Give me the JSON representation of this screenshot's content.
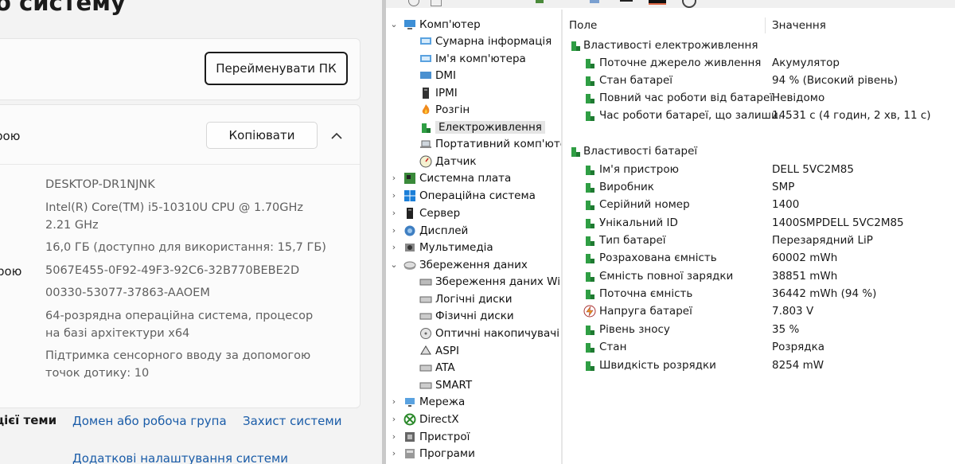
{
  "settings": {
    "title": "о систему",
    "rename_button": "Перейменувати ПК",
    "spec_label": "рою",
    "copy_button": "Копіювати",
    "spec_side_label": "рою",
    "lines": [
      "DESKTOP-DR1NJNK",
      "Intel(R) Core(TM) i5-10310U CPU @ 1.70GHz",
      "2.21 GHz",
      "16,0 ГБ (доступно для використання: 15,7 ГБ)",
      "5067E455-0F92-49F3-92C6-32B770BEBE2D",
      "00330-53077-37863-AAOEM",
      "64-розрядна операційна система, процесор",
      "на базі архітектури x64",
      "Підтримка сенсорного вводу за допомогою",
      "точок дотику: 10"
    ],
    "related_label": "цієї теми",
    "links": [
      "Домен або робоча група",
      "Захист системи",
      "Додаткові налаштування системи"
    ],
    "link_color": "#1a5ca8"
  },
  "tree": [
    {
      "label": "Комп'ютер",
      "arrow": "⌄",
      "icon": "computer-icon"
    },
    {
      "label": "Сумарна інформація",
      "icon": "summary-icon"
    },
    {
      "label": "Ім'я комп'ютера",
      "icon": "computer-name-icon"
    },
    {
      "label": "DMI",
      "icon": "dmi-icon"
    },
    {
      "label": "IPMI",
      "icon": "ipmi-icon"
    },
    {
      "label": "Розгін",
      "icon": "overclock-icon"
    },
    {
      "label": "Електроживлення",
      "icon": "power-icon"
    },
    {
      "label": "Портативний комп'ютер",
      "icon": "portable-icon"
    },
    {
      "label": "Датчик",
      "icon": "sensor-icon"
    },
    {
      "label": "Системна плата",
      "arrow": "›",
      "icon": "motherboard-icon"
    },
    {
      "label": "Операційна система",
      "arrow": "›",
      "icon": "os-icon"
    },
    {
      "label": "Сервер",
      "arrow": "›",
      "icon": "server-icon"
    },
    {
      "label": "Дисплей",
      "arrow": "›",
      "icon": "display-icon"
    },
    {
      "label": "Мультимедіа",
      "arrow": "›",
      "icon": "multimedia-icon"
    },
    {
      "label": "Збереження даних",
      "arrow": "⌄",
      "icon": "storage-icon"
    },
    {
      "label": "Збереження даних Wind",
      "icon": "storage-windows-icon"
    },
    {
      "label": "Логічні диски",
      "icon": "logical-disk-icon"
    },
    {
      "label": "Фізичні диски",
      "icon": "physical-disk-icon"
    },
    {
      "label": "Оптичні накопичувачі",
      "icon": "optical-drive-icon"
    },
    {
      "label": "ASPI",
      "icon": "aspi-icon"
    },
    {
      "label": "ATA",
      "icon": "ata-icon"
    },
    {
      "label": "SMART",
      "icon": "smart-icon"
    },
    {
      "label": "Мережа",
      "arrow": "›",
      "icon": "network-icon"
    },
    {
      "label": "DirectX",
      "arrow": "›",
      "icon": "directx-icon"
    },
    {
      "label": "Пристрої",
      "arrow": "›",
      "icon": "devices-icon"
    },
    {
      "label": "Програми",
      "arrow": "›",
      "icon": "programs-icon"
    }
  ],
  "list": {
    "col_field": "Поле",
    "col_value": "Значення",
    "groups": [
      {
        "title": "Властивості електроживлення",
        "items": [
          {
            "field": "Поточне джерело живлення",
            "value": "Акумулятор"
          },
          {
            "field": "Стан батареї",
            "value": "94 % (Високий рівень)"
          },
          {
            "field": "Повний час роботи від батареї",
            "value": "Невідомо"
          },
          {
            "field": "Час роботи батареї, що залиши...",
            "value": "14531 с (4 годин, 2 хв, 11 с)"
          }
        ]
      },
      {
        "title": "Властивості батареї",
        "items": [
          {
            "field": "Ім'я пристрою",
            "value": "DELL 5VC2M85"
          },
          {
            "field": "Виробник",
            "value": "SMP"
          },
          {
            "field": "Серійний номер",
            "value": "1400"
          },
          {
            "field": "Унікальний ID",
            "value": "1400SMPDELL 5VC2M85"
          },
          {
            "field": "Тип батареї",
            "value": "Перезарядний LiP"
          },
          {
            "field": "Розрахована ємність",
            "value": "60002 mWh"
          },
          {
            "field": "Ємність повної зарядки",
            "value": "38851 mWh"
          },
          {
            "field": "Поточна ємність",
            "value": "36442 mWh  (94 %)"
          },
          {
            "field": "Напруга батареї",
            "value": "7.803 V",
            "icon": "voltage-icon"
          },
          {
            "field": "Рівень зносу",
            "value": "35 %"
          },
          {
            "field": "Стан",
            "value": "Розрядка"
          },
          {
            "field": "Швидкість розрядки",
            "value": "8254 mW"
          }
        ]
      }
    ]
  }
}
